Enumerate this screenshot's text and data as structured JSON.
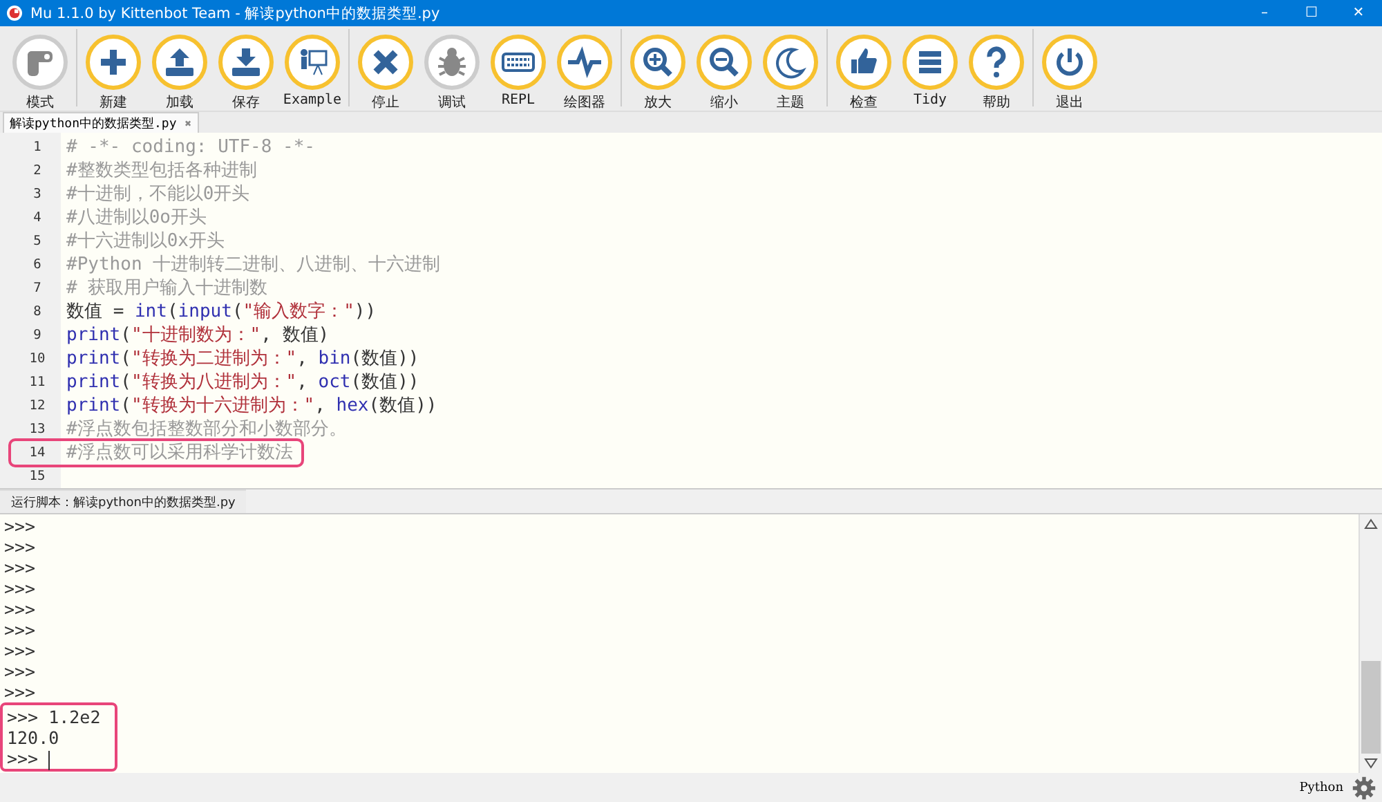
{
  "window": {
    "title": "Mu 1.1.0 by Kittenbot Team - 解读python中的数据类型.py",
    "controls": [
      "–",
      "☐",
      "✕"
    ]
  },
  "toolbar": [
    [
      {
        "label": "模式",
        "kind": "mode",
        "enabled": false
      }
    ],
    [
      {
        "label": "新建",
        "kind": "plus",
        "enabled": true
      },
      {
        "label": "加载",
        "kind": "upload",
        "enabled": true
      },
      {
        "label": "保存",
        "kind": "download",
        "enabled": true
      },
      {
        "label": "Example",
        "kind": "teacher",
        "enabled": true
      }
    ],
    [
      {
        "label": "停止",
        "kind": "cross",
        "enabled": true
      },
      {
        "label": "调试",
        "kind": "bug",
        "enabled": false
      },
      {
        "label": "REPL",
        "kind": "keyboard",
        "enabled": true
      },
      {
        "label": "绘图器",
        "kind": "pulse",
        "enabled": true
      }
    ],
    [
      {
        "label": "放大",
        "kind": "zoomin",
        "enabled": true
      },
      {
        "label": "缩小",
        "kind": "zoomout",
        "enabled": true
      },
      {
        "label": "主题",
        "kind": "moon",
        "enabled": true
      }
    ],
    [
      {
        "label": "检查",
        "kind": "thumb",
        "enabled": true
      },
      {
        "label": "Tidy",
        "kind": "lines",
        "enabled": true
      },
      {
        "label": "帮助",
        "kind": "help",
        "enabled": true
      }
    ],
    [
      {
        "label": "退出",
        "kind": "power",
        "enabled": true
      }
    ]
  ],
  "tabs": [
    {
      "label": "解读python中的数据类型.py",
      "selected": true,
      "close": "✖"
    }
  ],
  "editor": {
    "lines": [
      {
        "number": "1",
        "highlighted": false,
        "tokens": [
          {
            "kind": "comment",
            "text": "# -*- coding: UTF-8 -*-"
          }
        ]
      },
      {
        "number": "2",
        "highlighted": false,
        "tokens": [
          {
            "kind": "comment",
            "text": "#整数类型包括各种进制"
          }
        ]
      },
      {
        "number": "3",
        "highlighted": false,
        "tokens": [
          {
            "kind": "comment",
            "text": "#十进制，不能以0开头"
          }
        ]
      },
      {
        "number": "4",
        "highlighted": false,
        "tokens": [
          {
            "kind": "comment",
            "text": "#八进制以0o开头"
          }
        ]
      },
      {
        "number": "5",
        "highlighted": false,
        "tokens": [
          {
            "kind": "comment",
            "text": "#十六进制以0x开头"
          }
        ]
      },
      {
        "number": "6",
        "highlighted": false,
        "tokens": [
          {
            "kind": "comment",
            "text": "#Python 十进制转二进制、八进制、十六进制"
          }
        ]
      },
      {
        "number": "7",
        "highlighted": false,
        "tokens": [
          {
            "kind": "comment",
            "text": "# 获取用户输入十进制数"
          }
        ]
      },
      {
        "number": "8",
        "highlighted": false,
        "tokens": [
          {
            "kind": "plain",
            "text": "数值 = "
          },
          {
            "kind": "builtin",
            "text": "int"
          },
          {
            "kind": "plain",
            "text": "("
          },
          {
            "kind": "builtin",
            "text": "input"
          },
          {
            "kind": "plain",
            "text": "("
          },
          {
            "kind": "string",
            "text": "\"输入数字：\""
          },
          {
            "kind": "plain",
            "text": "))"
          }
        ]
      },
      {
        "number": "9",
        "highlighted": false,
        "tokens": [
          {
            "kind": "builtin",
            "text": "print"
          },
          {
            "kind": "plain",
            "text": "("
          },
          {
            "kind": "string",
            "text": "\"十进制数为：\""
          },
          {
            "kind": "plain",
            "text": ", 数值)"
          }
        ]
      },
      {
        "number": "10",
        "highlighted": false,
        "tokens": [
          {
            "kind": "builtin",
            "text": "print"
          },
          {
            "kind": "plain",
            "text": "("
          },
          {
            "kind": "string",
            "text": "\"转换为二进制为：\""
          },
          {
            "kind": "plain",
            "text": ", "
          },
          {
            "kind": "builtin",
            "text": "bin"
          },
          {
            "kind": "plain",
            "text": "(数值))"
          }
        ]
      },
      {
        "number": "11",
        "highlighted": false,
        "tokens": [
          {
            "kind": "builtin",
            "text": "print"
          },
          {
            "kind": "plain",
            "text": "("
          },
          {
            "kind": "string",
            "text": "\"转换为八进制为：\""
          },
          {
            "kind": "plain",
            "text": ", "
          },
          {
            "kind": "builtin",
            "text": "oct"
          },
          {
            "kind": "plain",
            "text": "(数值))"
          }
        ]
      },
      {
        "number": "12",
        "highlighted": false,
        "tokens": [
          {
            "kind": "builtin",
            "text": "print"
          },
          {
            "kind": "plain",
            "text": "("
          },
          {
            "kind": "string",
            "text": "\"转换为十六进制为：\""
          },
          {
            "kind": "plain",
            "text": ", "
          },
          {
            "kind": "builtin",
            "text": "hex"
          },
          {
            "kind": "plain",
            "text": "(数值))"
          }
        ]
      },
      {
        "number": "13",
        "highlighted": false,
        "tokens": [
          {
            "kind": "comment",
            "text": "#浮点数包括整数部分和小数部分。"
          }
        ]
      },
      {
        "number": "14",
        "highlighted": true,
        "tokens": [
          {
            "kind": "comment",
            "text": "#浮点数可以采用科学计数法"
          }
        ]
      },
      {
        "number": "15",
        "highlighted": false
      }
    ]
  },
  "console": {
    "title": "运行脚本：解读python中的数据类型.py",
    "lines": [
      {
        "text": ">>>",
        "highlighted": false
      },
      {
        "text": ">>>",
        "highlighted": false
      },
      {
        "text": ">>>",
        "highlighted": false
      },
      {
        "text": ">>>",
        "highlighted": false
      },
      {
        "text": ">>>",
        "highlighted": false
      },
      {
        "text": ">>>",
        "highlighted": false
      },
      {
        "text": ">>>",
        "highlighted": false
      },
      {
        "text": ">>>",
        "highlighted": false
      },
      {
        "text": ">>>",
        "highlighted": false
      },
      {
        "text": ">>> 1.2e2",
        "highlighted": true
      },
      {
        "text": "120.0",
        "highlighted": true
      },
      {
        "text": ">>> ",
        "highlighted": true,
        "cursor": true
      }
    ]
  },
  "status_bar": {
    "mode": "Python"
  }
}
